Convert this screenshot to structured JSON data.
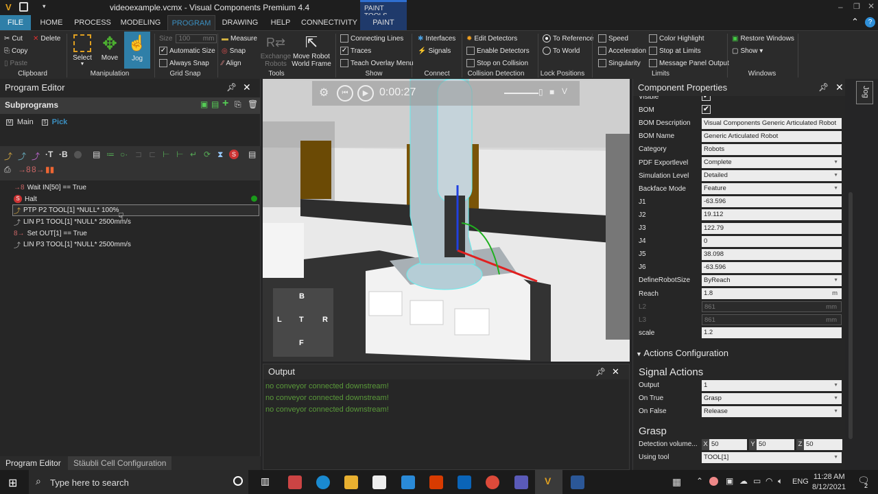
{
  "window": {
    "title": "videoexample.vcmx - Visual Components Premium 4.4",
    "context_tab_group": "PAINT TOOLS"
  },
  "tabs": [
    {
      "label": "FILE"
    },
    {
      "label": "HOME"
    },
    {
      "label": "PROCESS"
    },
    {
      "label": "MODELING"
    },
    {
      "label": "PROGRAM"
    },
    {
      "label": "DRAWING"
    },
    {
      "label": "HELP"
    },
    {
      "label": "CONNECTIVITY"
    },
    {
      "label": "PAINT"
    }
  ],
  "ribbon": {
    "clipboard": {
      "cut": "Cut",
      "delete": "Delete",
      "copy": "Copy",
      "paste": "Paste",
      "label": "Clipboard"
    },
    "manipulation": {
      "select": "Select",
      "move": "Move",
      "jog": "Jog",
      "label": "Manipulation"
    },
    "grid_snap": {
      "size_label": "Size",
      "size_value": "100",
      "size_unit": "mm",
      "automatic_size": "Automatic Size",
      "always_snap": "Always Snap",
      "label": "Grid Snap"
    },
    "tools": {
      "measure": "Measure",
      "snap": "Snap",
      "align": "Align",
      "exchange": "Exchange Robots",
      "move_robot": "Move Robot World Frame",
      "label": "Tools"
    },
    "show": {
      "connecting_lines": "Connecting Lines",
      "traces": "Traces",
      "teach_overlay": "Teach Overlay Menu",
      "label": "Show"
    },
    "connect": {
      "interfaces": "Interfaces",
      "signals": "Signals",
      "label": "Connect"
    },
    "collision": {
      "edit": "Edit Detectors",
      "enable": "Enable Detectors",
      "stop": "Stop on Collision",
      "label": "Collision Detection"
    },
    "lock": {
      "to_reference": "To Reference",
      "to_world": "To World",
      "label": "Lock Positions"
    },
    "limits": {
      "speed": "Speed",
      "acceleration": "Acceleration",
      "singularity": "Singularity",
      "color_highlight": "Color Highlight",
      "stop_at_limits": "Stop at Limits",
      "message_panel": "Message Panel Output",
      "label": "Limits"
    },
    "windows": {
      "restore": "Restore Windows",
      "show": "Show ▾",
      "label": "Windows"
    }
  },
  "program_editor": {
    "title": "Program Editor",
    "subprograms_title": "Subprograms",
    "subprograms": [
      "Main",
      "Pick"
    ],
    "statements": [
      "Wait IN[50] == True",
      "Halt",
      "PTP P2 TOOL[1] *NULL* 100%",
      "LIN P1 TOOL[1] *NULL* 2500mm/s",
      "Set OUT[1] == True",
      "LIN P3 TOOL[1] *NULL* 2500mm/s"
    ],
    "bottom_tabs": [
      "Program Editor",
      "Stäubli Cell Configuration"
    ]
  },
  "viewport": {
    "time": "0:00:27",
    "cube": {
      "top": "T",
      "back": "B",
      "left": "L",
      "right": "R",
      "front": "F"
    }
  },
  "output": {
    "title": "Output",
    "lines": [
      "no conveyor connected downstream!",
      "no conveyor connected downstream!",
      "no conveyor connected downstream!"
    ]
  },
  "properties": {
    "title": "Component Properties",
    "jog_tab": "Jog",
    "rows": [
      {
        "label": "Visible",
        "value": "✔",
        "kind": "check"
      },
      {
        "label": "BOM",
        "value": "✔",
        "kind": "check"
      },
      {
        "label": "BOM Description",
        "value": "Visual Components Generic Articulated Robot"
      },
      {
        "label": "BOM Name",
        "value": "Generic Articulated Robot"
      },
      {
        "label": "Category",
        "value": "Robots"
      },
      {
        "label": "PDF Exportlevel",
        "value": "Complete",
        "kind": "select"
      },
      {
        "label": "Simulation Level",
        "value": "Detailed",
        "kind": "select"
      },
      {
        "label": "Backface Mode",
        "value": "Feature",
        "kind": "select"
      },
      {
        "label": "J1",
        "value": "-63.596"
      },
      {
        "label": "J2",
        "value": "19.112"
      },
      {
        "label": "J3",
        "value": "122.79"
      },
      {
        "label": "J4",
        "value": "0"
      },
      {
        "label": "J5",
        "value": "38.098"
      },
      {
        "label": "J6",
        "value": "-63.596"
      },
      {
        "label": "DefineRobotSize",
        "value": "ByReach",
        "kind": "select"
      },
      {
        "label": "Reach",
        "value": "1.8",
        "unit": "m"
      },
      {
        "label": "L2",
        "value": "861",
        "unit": "mm",
        "kind": "disabled"
      },
      {
        "label": "L3",
        "value": "861",
        "unit": "mm",
        "kind": "disabled"
      },
      {
        "label": "scale",
        "value": "1.2"
      }
    ],
    "actions_section": "Actions Configuration",
    "signal_actions": {
      "title": "Signal Actions",
      "output_label": "Output",
      "output": "1",
      "on_true_label": "On True",
      "on_true": "Grasp",
      "on_false_label": "On False",
      "on_false": "Release"
    },
    "grasp": {
      "title": "Grasp",
      "detection_label": "Detection volume...",
      "x": "50",
      "y": "50",
      "z": "50",
      "using_tool_label": "Using tool",
      "using_tool": "TOOL[1]"
    }
  },
  "taskbar": {
    "search_placeholder": "Type here to search",
    "lang": "ENG",
    "time": "11:28 AM",
    "date": "8/12/2021",
    "notifications": "2"
  },
  "colors": {
    "accent": "#2f7fa8",
    "output_text": "#5a9a3a",
    "context_tab": "#1f3a6b"
  }
}
